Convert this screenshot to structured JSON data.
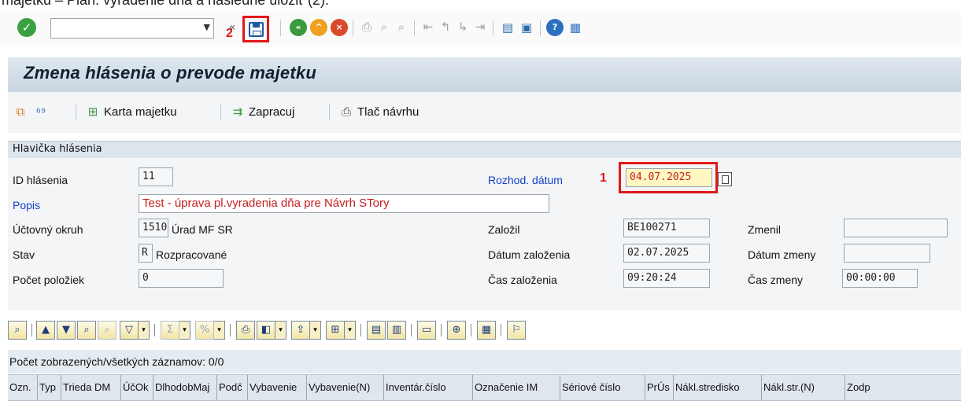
{
  "caption": "majetku – Plán. vyradenie dňa a následne uložiť (2).",
  "toolbar": {
    "command_value": "",
    "annotation_save": "2"
  },
  "title": "Zmena hlásenia o prevode majetku",
  "app_toolbar": {
    "asset_card": "Karta majetku",
    "process": "Zapracuj",
    "print_draft": "Tlač návrhu"
  },
  "header_group": {
    "title": "Hlavička hlásenia",
    "fields": {
      "id_label": "ID hlásenia",
      "id_value": "11",
      "popis_label": "Popis",
      "popis_value": "Test - úprava pl.vyradenia dňa pre Návrh STory",
      "ucet_label": "Účtovný okruh",
      "ucet_code": "1510",
      "ucet_name": "Úrad MF SR",
      "stav_label": "Stav",
      "stav_code": "R",
      "stav_name": "Rozpracované",
      "pocet_label": "Počet položiek",
      "pocet_value": "0",
      "rozhod_label": "Rozhod. dátum",
      "annotation_date": "1",
      "rozhod_value": "04.07.2025",
      "zalozil_label": "Založil",
      "zalozil_value": "BE100271",
      "datum_zal_label": "Dátum založenia",
      "datum_zal_value": "02.07.2025",
      "cas_zal_label": "Čas založenia",
      "cas_zal_value": "09:20:24",
      "zmenil_label": "Zmenil",
      "zmenil_value": "",
      "datum_zm_label": "Dátum zmeny",
      "datum_zm_value": "",
      "cas_zm_label": "Čas zmeny",
      "cas_zm_value": "00:00:00"
    }
  },
  "grid": {
    "count_text": "Počet zobrazených/všetkých záznamov: 0/0",
    "columns": [
      "Ozn.",
      "Typ",
      "Trieda DM",
      "ÚčOk",
      "DlhodobMaj",
      "Podč",
      "Vybavenie",
      "Vybavenie(N)",
      "Inventár.číslo",
      "Označenie IM",
      "Sériové číslo",
      "PrÚs",
      "Nákl.stredisko",
      "Nákl.str.(N)",
      "Zodp"
    ]
  },
  "colors": {
    "annotation_red": "#e21818",
    "label_blue": "#1540c8",
    "title_band": "#c9d5e1"
  }
}
